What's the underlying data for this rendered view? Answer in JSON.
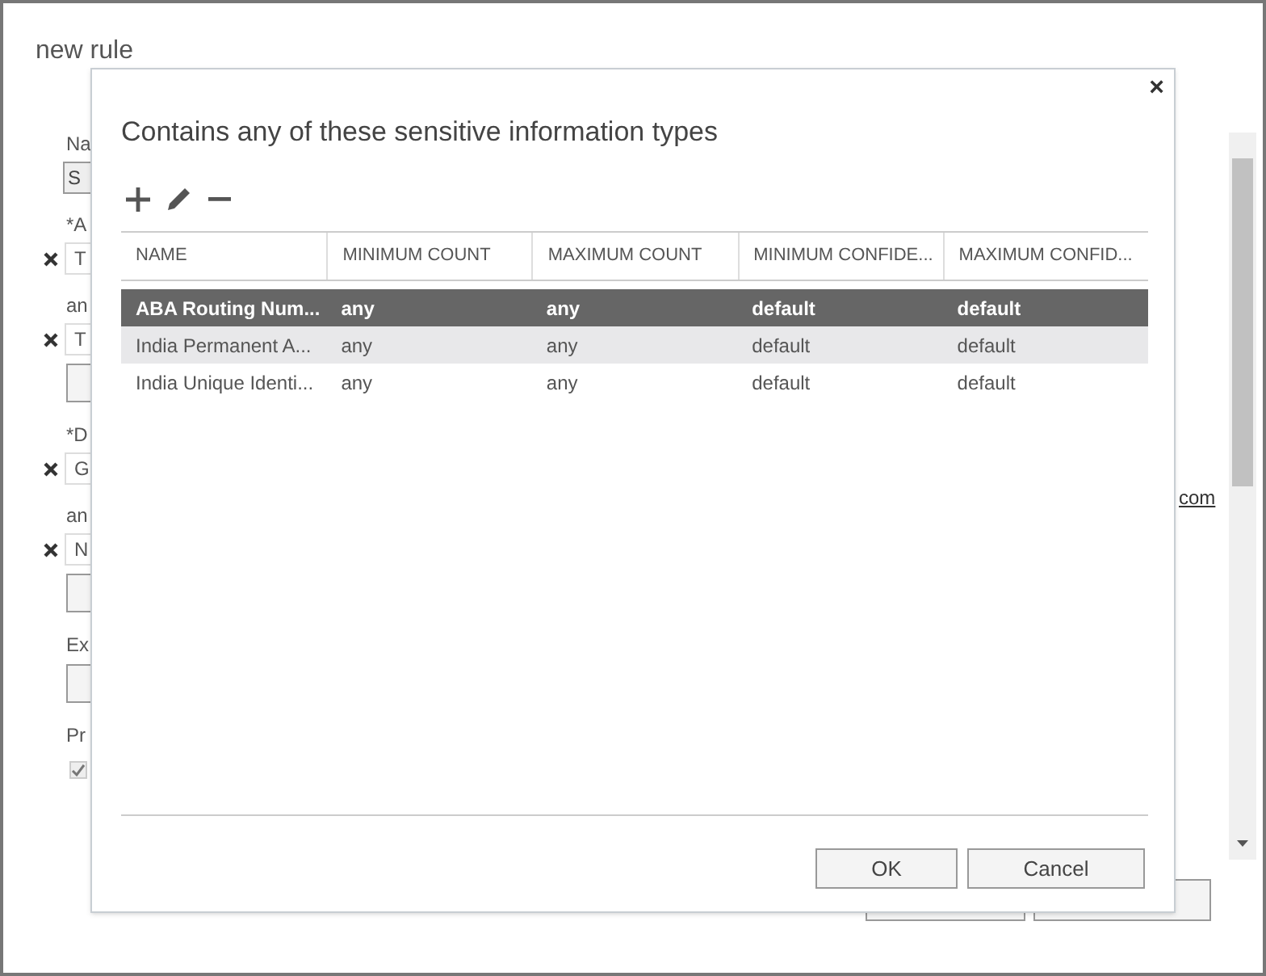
{
  "page": {
    "title": "new rule",
    "items": [
      {
        "kind": "label",
        "text": "Na"
      },
      {
        "kind": "field",
        "text": "S"
      },
      {
        "kind": "label",
        "text": "*A"
      },
      {
        "kind": "removable",
        "text": "T"
      },
      {
        "kind": "label",
        "text": "an"
      },
      {
        "kind": "removable",
        "text": "T"
      },
      {
        "kind": "box"
      },
      {
        "kind": "label",
        "text": "*D"
      },
      {
        "kind": "removable",
        "text": "G"
      },
      {
        "kind": "label",
        "text": "an"
      },
      {
        "kind": "removable",
        "text": "N"
      },
      {
        "kind": "box"
      },
      {
        "kind": "label",
        "text": "Ex"
      },
      {
        "kind": "box"
      },
      {
        "kind": "label",
        "text": "Pr"
      },
      {
        "kind": "checkbox",
        "checked": true
      }
    ],
    "link": "com"
  },
  "dialog": {
    "title": "Contains any of these sensitive information types",
    "close": "×",
    "columns": [
      "NAME",
      "MINIMUM COUNT",
      "MAXIMUM COUNT",
      "MINIMUM CONFIDE...",
      "MAXIMUM CONFID..."
    ],
    "rows": [
      {
        "cells": [
          "ABA Routing Num...",
          "any",
          "any",
          "default",
          "default"
        ],
        "selected": true,
        "hovered": false
      },
      {
        "cells": [
          "India Permanent A...",
          "any",
          "any",
          "default",
          "default"
        ],
        "selected": false,
        "hovered": true
      },
      {
        "cells": [
          "India Unique Identi...",
          "any",
          "any",
          "default",
          "default"
        ],
        "selected": false,
        "hovered": false
      }
    ],
    "buttons": [
      "OK",
      "Cancel"
    ]
  }
}
